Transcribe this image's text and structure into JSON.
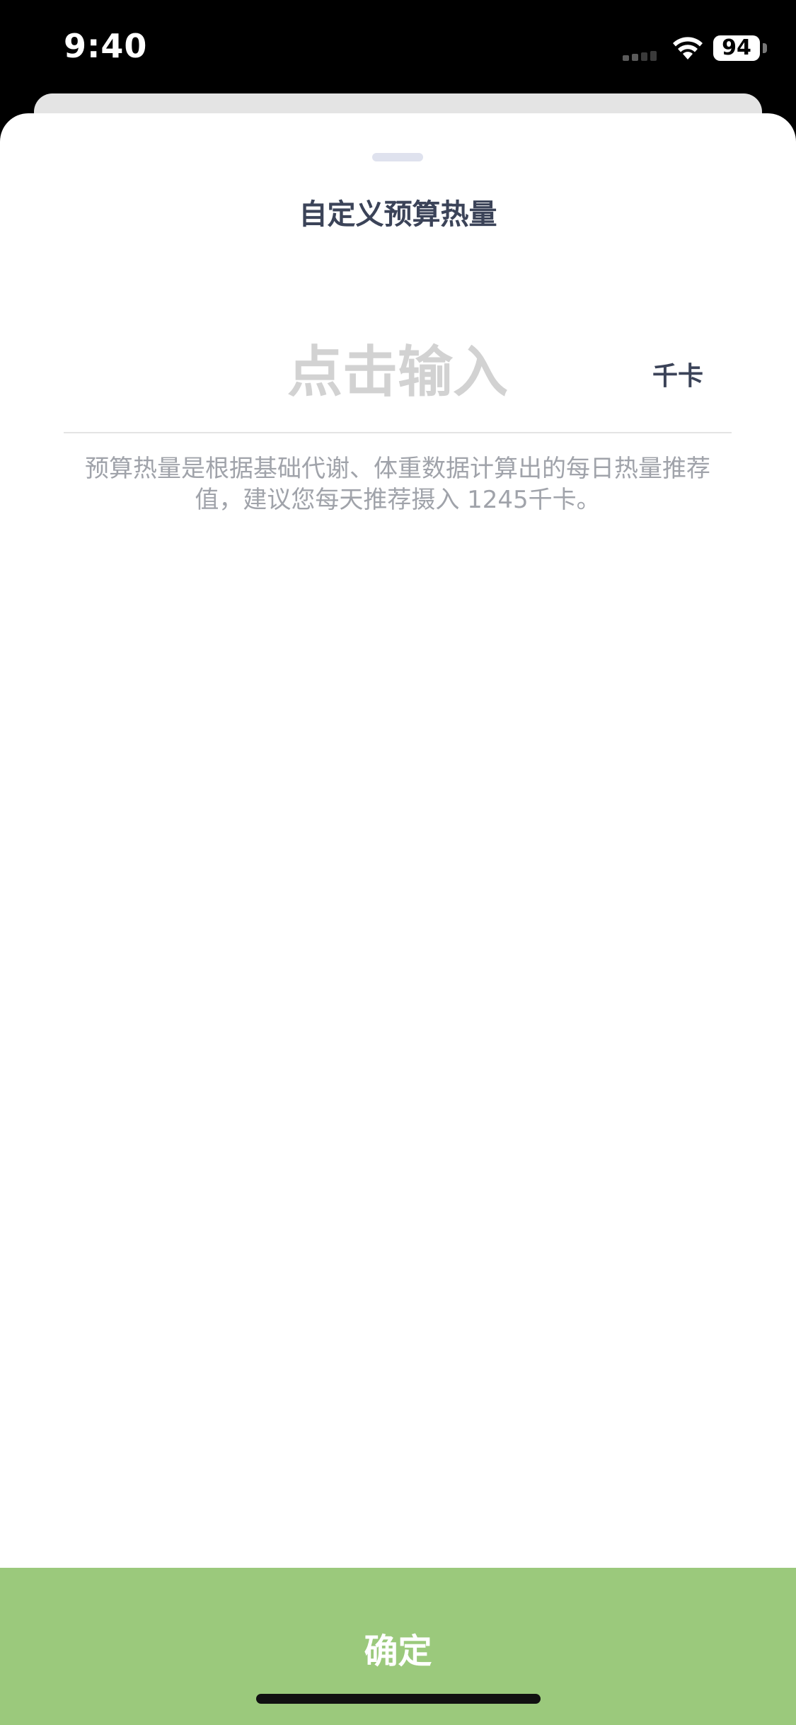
{
  "status_bar": {
    "time": "9:40",
    "battery_level": "94",
    "icons": [
      "signal-icon",
      "wifi-icon",
      "battery-icon"
    ]
  },
  "sheet": {
    "title": "自定义预算热量",
    "input": {
      "value": "",
      "placeholder": "点击输入"
    },
    "unit": "千卡",
    "hint": "预算热量是根据基础代谢、体重数据计算出的每日热量推荐值，建议您每天推荐摄入  1245千卡。"
  },
  "confirm_button": {
    "label": "确定"
  },
  "colors": {
    "accent": "#9bc97c",
    "title_text": "#3b4358",
    "hint_text": "#a0a3aa",
    "placeholder": "#d2d2d2"
  }
}
